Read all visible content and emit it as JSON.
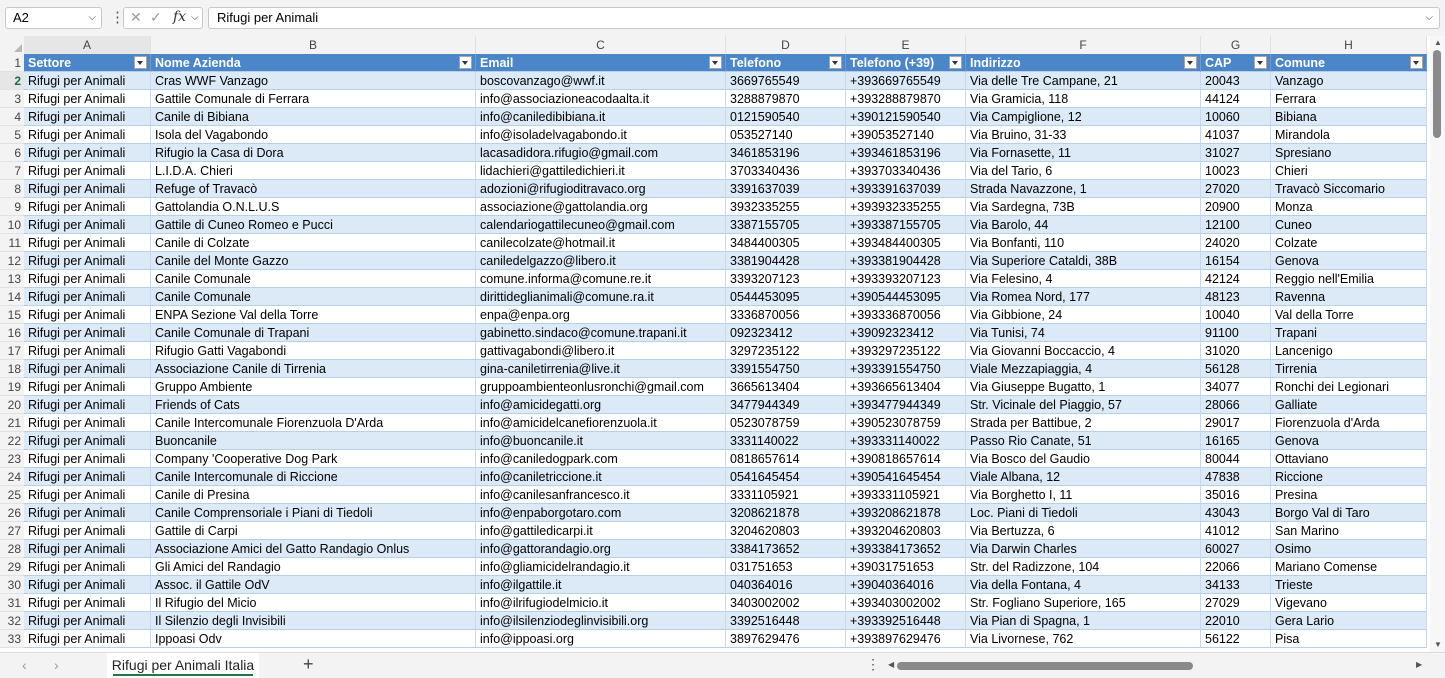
{
  "formula_bar": {
    "name_box": "A2",
    "formula_text": "Rifugi per Animali"
  },
  "columns": [
    "A",
    "B",
    "C",
    "D",
    "E",
    "F",
    "G",
    "H"
  ],
  "header_row": {
    "number": "1",
    "cells": [
      "Settore",
      "Nome Azienda",
      "Email",
      "Telefono",
      "Telefono (+39)",
      "Indirizzo",
      "CAP",
      "Comune"
    ]
  },
  "rows": [
    {
      "n": "2",
      "c": [
        "Rifugi per Animali",
        "Cras WWF Vanzago",
        "boscovanzago@wwf.it",
        "3669765549",
        "+393669765549",
        "Via delle Tre Campane, 21",
        "20043",
        "Vanzago"
      ]
    },
    {
      "n": "3",
      "c": [
        "Rifugi per Animali",
        "Gattile Comunale di Ferrara",
        "info@associazioneacodaalta.it",
        "3288879870",
        "+393288879870",
        "Via Gramicia, 118",
        "44124",
        "Ferrara"
      ]
    },
    {
      "n": "4",
      "c": [
        "Rifugi per Animali",
        "Canile di Bibiana",
        "info@caniledibibiana.it",
        "0121590540",
        "+390121590540",
        "Via Campiglione, 12",
        "10060",
        "Bibiana"
      ]
    },
    {
      "n": "5",
      "c": [
        "Rifugi per Animali",
        "Isola del Vagabondo",
        "info@isoladelvagabondo.it",
        "053527140",
        "+39053527140",
        "Via Bruino, 31-33",
        "41037",
        "Mirandola"
      ]
    },
    {
      "n": "6",
      "c": [
        "Rifugi per Animali",
        "Rifugio la Casa di Dora",
        "lacasadidora.rifugio@gmail.com",
        "3461853196",
        "+393461853196",
        "Via Fornasette, 11",
        "31027",
        "Spresiano"
      ]
    },
    {
      "n": "7",
      "c": [
        "Rifugi per Animali",
        "L.I.D.A. Chieri",
        "lidachieri@gattiledichieri.it",
        "3703340436",
        "+393703340436",
        "Via del Tario, 6",
        "10023",
        "Chieri"
      ]
    },
    {
      "n": "8",
      "c": [
        "Rifugi per Animali",
        "Refuge of Travacò",
        "adozioni@rifugioditravaco.org",
        "3391637039",
        "+393391637039",
        "Strada Navazzone, 1",
        "27020",
        "Travacò Siccomario"
      ]
    },
    {
      "n": "9",
      "c": [
        "Rifugi per Animali",
        "Gattolandia O.N.L.U.S",
        "associazione@gattolandia.org",
        "3932335255",
        "+393932335255",
        "Via Sardegna, 73B",
        "20900",
        "Monza"
      ]
    },
    {
      "n": "10",
      "c": [
        "Rifugi per Animali",
        "Gattile di Cuneo Romeo e Pucci",
        "calendariogattilecuneo@gmail.com",
        "3387155705",
        "+393387155705",
        "Via Barolo, 44",
        "12100",
        "Cuneo"
      ]
    },
    {
      "n": "11",
      "c": [
        "Rifugi per Animali",
        "Canile di Colzate",
        "canilecolzate@hotmail.it",
        "3484400305",
        "+393484400305",
        "Via Bonfanti, 110",
        "24020",
        "Colzate"
      ]
    },
    {
      "n": "12",
      "c": [
        "Rifugi per Animali",
        "Canile del Monte Gazzo",
        "caniledelgazzo@libero.it",
        "3381904428",
        "+393381904428",
        "Via Superiore Cataldi, 38B",
        "16154",
        "Genova"
      ]
    },
    {
      "n": "13",
      "c": [
        "Rifugi per Animali",
        "Canile Comunale",
        "comune.informa@comune.re.it",
        "3393207123",
        "+393393207123",
        "Via Felesino, 4",
        "42124",
        "Reggio nell'Emilia"
      ]
    },
    {
      "n": "14",
      "c": [
        "Rifugi per Animali",
        "Canile Comunale",
        "dirittideglianimali@comune.ra.it",
        "0544453095",
        "+390544453095",
        "Via Romea Nord, 177",
        "48123",
        "Ravenna"
      ]
    },
    {
      "n": "15",
      "c": [
        "Rifugi per Animali",
        "ENPA Sezione Val della Torre",
        "enpa@enpa.org",
        "3336870056",
        "+393336870056",
        "Via Gibbione, 24",
        "10040",
        "Val della Torre"
      ]
    },
    {
      "n": "16",
      "c": [
        "Rifugi per Animali",
        "Canile Comunale di Trapani",
        "gabinetto.sindaco@comune.trapani.it",
        "092323412",
        "+39092323412",
        "Via Tunisi, 74",
        "91100",
        "Trapani"
      ]
    },
    {
      "n": "17",
      "c": [
        "Rifugi per Animali",
        "Rifugio Gatti Vagabondi",
        "gattivagabondi@libero.it",
        "3297235122",
        "+393297235122",
        "Via Giovanni Boccaccio, 4",
        "31020",
        "Lancenigo"
      ]
    },
    {
      "n": "18",
      "c": [
        "Rifugi per Animali",
        "Associazione Canile di Tirrenia",
        "gina-caniletirrenia@live.it",
        "3391554750",
        "+393391554750",
        "Viale Mezzapiaggia, 4",
        "56128",
        "Tirrenia"
      ]
    },
    {
      "n": "19",
      "c": [
        "Rifugi per Animali",
        "Gruppo Ambiente",
        "gruppoambienteonlusronchi@gmail.com",
        "3665613404",
        "+393665613404",
        "Via Giuseppe Bugatto, 1",
        "34077",
        "Ronchi dei Legionari"
      ]
    },
    {
      "n": "20",
      "c": [
        "Rifugi per Animali",
        "Friends of Cats",
        "info@amicidegatti.org",
        "3477944349",
        "+393477944349",
        "Str. Vicinale del Piaggio, 57",
        "28066",
        "Galliate"
      ]
    },
    {
      "n": "21",
      "c": [
        "Rifugi per Animali",
        "Canile Intercomunale Fiorenzuola D'Arda",
        "info@amicidelcanefiorenzuola.it",
        "0523078759",
        "+390523078759",
        "Strada per Battibue, 2",
        "29017",
        "Fiorenzuola d'Arda"
      ]
    },
    {
      "n": "22",
      "c": [
        "Rifugi per Animali",
        "Buoncanile",
        "info@buoncanile.it",
        "3331140022",
        "+393331140022",
        "Passo Rio Canate, 51",
        "16165",
        "Genova"
      ]
    },
    {
      "n": "23",
      "c": [
        "Rifugi per Animali",
        "Company 'Cooperative Dog Park",
        "info@caniledogpark.com",
        "0818657614",
        "+390818657614",
        "Via Bosco del Gaudio",
        "80044",
        "Ottaviano"
      ]
    },
    {
      "n": "24",
      "c": [
        "Rifugi per Animali",
        "Canile Intercomunale di Riccione",
        "info@caniletriccione.it",
        "0541645454",
        "+390541645454",
        "Viale Albana, 12",
        "47838",
        "Riccione"
      ]
    },
    {
      "n": "25",
      "c": [
        "Rifugi per Animali",
        "Canile di Presina",
        "info@canilesanfrancesco.it",
        "3331105921",
        "+393331105921",
        "Via Borghetto I, 11",
        "35016",
        "Presina"
      ]
    },
    {
      "n": "26",
      "c": [
        "Rifugi per Animali",
        "Canile Comprensoriale i Piani di Tiedoli",
        "info@enpaborgotaro.com",
        "3208621878",
        "+393208621878",
        "Loc. Piani di Tiedoli",
        "43043",
        "Borgo Val di Taro"
      ]
    },
    {
      "n": "27",
      "c": [
        "Rifugi per Animali",
        "Gattile di Carpi",
        "info@gattiledicarpi.it",
        "3204620803",
        "+393204620803",
        "Via Bertuzza, 6",
        "41012",
        "San Marino"
      ]
    },
    {
      "n": "28",
      "c": [
        "Rifugi per Animali",
        "Associazione Amici del Gatto Randagio Onlus",
        "info@gattorandagio.org",
        "3384173652",
        "+393384173652",
        "Via Darwin Charles",
        "60027",
        "Osimo"
      ]
    },
    {
      "n": "29",
      "c": [
        "Rifugi per Animali",
        "Gli Amici del Randagio",
        "info@gliamicidelrandagio.it",
        "031751653",
        "+39031751653",
        "Str. del Radizzone, 104",
        "22066",
        "Mariano Comense"
      ]
    },
    {
      "n": "30",
      "c": [
        "Rifugi per Animali",
        "Assoc. il Gattile OdV",
        "info@ilgattile.it",
        "040364016",
        "+39040364016",
        "Via della Fontana, 4",
        "34133",
        "Trieste"
      ]
    },
    {
      "n": "31",
      "c": [
        "Rifugi per Animali",
        "Il Rifugio del Micio",
        "info@ilrifugiodelmicio.it",
        "3403002002",
        "+393403002002",
        "Str. Fogliano Superiore, 165",
        "27029",
        "Vigevano"
      ]
    },
    {
      "n": "32",
      "c": [
        "Rifugi per Animali",
        "Il Silenzio degli Invisibili",
        "info@ilsilenziodeglinvisibili.org",
        "3392516448",
        "+393392516448",
        "Via Pian di Spagna, 1",
        "22010",
        "Gera Lario"
      ]
    },
    {
      "n": "33",
      "c": [
        "Rifugi per Animali",
        "Ippoasi Odv",
        "info@ippoasi.org",
        "3897629476",
        "+393897629476",
        "Via Livornese, 762",
        "56122",
        "Pisa"
      ]
    }
  ],
  "sheet_tab": {
    "label": "Rifugi per Animali Italia"
  },
  "icons": {
    "cancel": "✕",
    "confirm": "✓",
    "fx": "fx",
    "chevron": "⌄",
    "prev_sheet": "‹",
    "next_sheet": "›",
    "add_sheet": "+",
    "more": "⋮"
  },
  "colors": {
    "header_fill": "#4a86c8",
    "band_fill": "#dce9f6",
    "selection_green": "#1f7a45"
  }
}
